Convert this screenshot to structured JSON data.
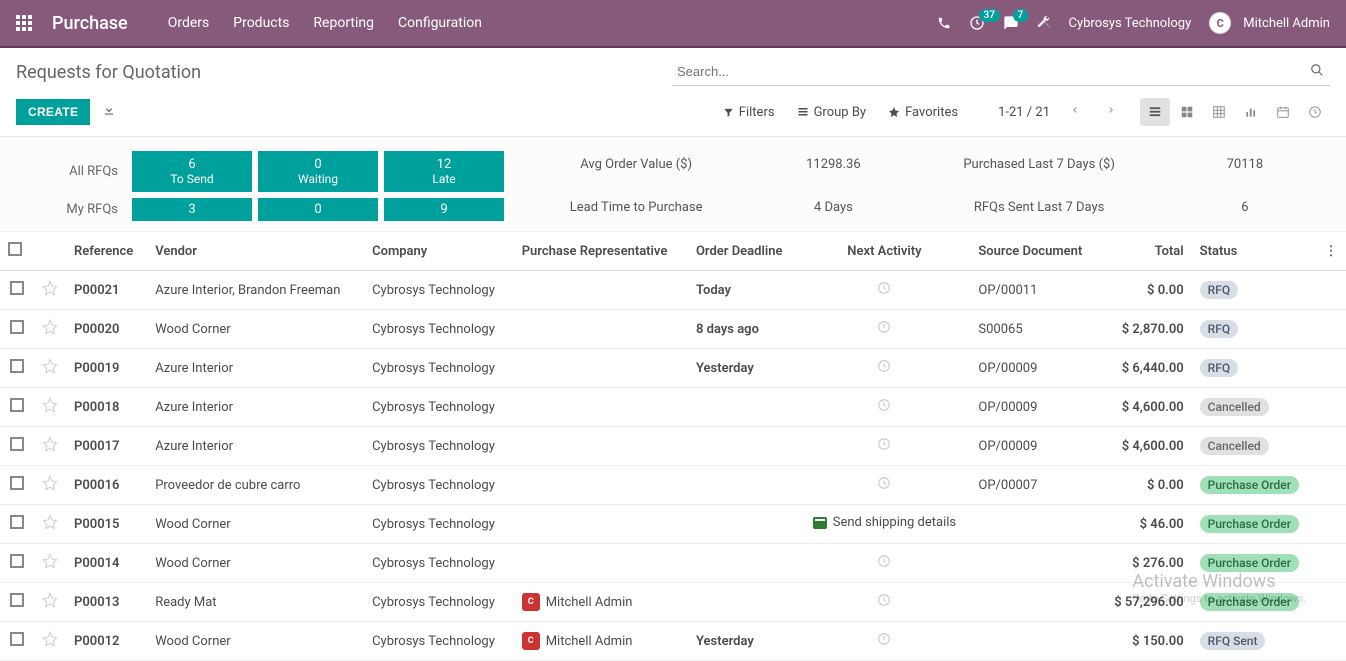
{
  "header": {
    "brand": "Purchase",
    "menu": [
      "Orders",
      "Products",
      "Reporting",
      "Configuration"
    ],
    "call_badge": "37",
    "msg_badge": "7",
    "company": "Cybrosys Technology",
    "user": "Mitchell Admin"
  },
  "page": {
    "title": "Requests for Quotation",
    "search_placeholder": "Search...",
    "create_label": "CREATE",
    "filters_label": "Filters",
    "groupby_label": "Group By",
    "favorites_label": "Favorites",
    "pager": "1-21 / 21"
  },
  "dashboard": {
    "row1_label": "All RFQs",
    "row2_label": "My RFQs",
    "tiles_top": [
      {
        "num": "6",
        "label": "To Send"
      },
      {
        "num": "0",
        "label": "Waiting"
      },
      {
        "num": "12",
        "label": "Late"
      }
    ],
    "tiles_bottom": [
      "3",
      "0",
      "9"
    ],
    "metrics": {
      "avg_label": "Avg Order Value ($)",
      "avg_value": "11298.36",
      "lead_label": "Lead Time to Purchase",
      "lead_value": "4  Days",
      "purchased_label": "Purchased Last 7 Days ($)",
      "purchased_value": "70118",
      "sent_label": "RFQs Sent Last 7 Days",
      "sent_value": "6"
    }
  },
  "table": {
    "headers": {
      "reference": "Reference",
      "vendor": "Vendor",
      "company": "Company",
      "rep": "Purchase Representative",
      "deadline": "Order Deadline",
      "activity": "Next Activity",
      "source": "Source Document",
      "total": "Total",
      "status": "Status"
    },
    "rows": [
      {
        "ref": "P00021",
        "vendor": "Azure Interior, Brandon Freeman",
        "company": "Cybrosys Technology",
        "rep": "",
        "deadline": "Today",
        "deadline_class": "deadline-today",
        "activity": "",
        "source": "OP/00011",
        "total": "$ 0.00",
        "status": "RFQ",
        "status_class": "status-rfq"
      },
      {
        "ref": "P00020",
        "vendor": "Wood Corner",
        "company": "Cybrosys Technology",
        "rep": "",
        "deadline": "8 days ago",
        "deadline_class": "deadline-past",
        "activity": "",
        "source": "S00065",
        "total": "$ 2,870.00",
        "status": "RFQ",
        "status_class": "status-rfq"
      },
      {
        "ref": "P00019",
        "vendor": "Azure Interior",
        "company": "Cybrosys Technology",
        "rep": "",
        "deadline": "Yesterday",
        "deadline_class": "deadline-past",
        "activity": "",
        "source": "OP/00009",
        "total": "$ 6,440.00",
        "status": "RFQ",
        "status_class": "status-rfq"
      },
      {
        "ref": "P00018",
        "vendor": "Azure Interior",
        "company": "Cybrosys Technology",
        "rep": "",
        "deadline": "",
        "deadline_class": "",
        "activity": "",
        "source": "OP/00009",
        "total": "$ 4,600.00",
        "status": "Cancelled",
        "status_class": "status-cancel"
      },
      {
        "ref": "P00017",
        "vendor": "Azure Interior",
        "company": "Cybrosys Technology",
        "rep": "",
        "deadline": "",
        "deadline_class": "",
        "activity": "",
        "source": "OP/00009",
        "total": "$ 4,600.00",
        "status": "Cancelled",
        "status_class": "status-cancel"
      },
      {
        "ref": "P00016",
        "vendor": "Proveedor de cubre carro",
        "company": "Cybrosys Technology",
        "rep": "",
        "deadline": "",
        "deadline_class": "",
        "activity": "",
        "source": "OP/00007",
        "total": "$ 0.00",
        "status": "Purchase Order",
        "status_class": "status-po"
      },
      {
        "ref": "P00015",
        "vendor": "Wood Corner",
        "company": "Cybrosys Technology",
        "rep": "",
        "deadline": "",
        "deadline_class": "",
        "activity": "Send shipping details",
        "source": "",
        "total": "$ 46.00",
        "status": "Purchase Order",
        "status_class": "status-po"
      },
      {
        "ref": "P00014",
        "vendor": "Wood Corner",
        "company": "Cybrosys Technology",
        "rep": "",
        "deadline": "",
        "deadline_class": "",
        "activity": "",
        "source": "",
        "total": "$ 276.00",
        "status": "Purchase Order",
        "status_class": "status-po"
      },
      {
        "ref": "P00013",
        "vendor": "Ready Mat",
        "company": "Cybrosys Technology",
        "rep": "Mitchell Admin",
        "deadline": "",
        "deadline_class": "",
        "activity": "",
        "source": "",
        "total": "$ 57,296.00",
        "status": "Purchase Order",
        "status_class": "status-po"
      },
      {
        "ref": "P00012",
        "vendor": "Wood Corner",
        "company": "Cybrosys Technology",
        "rep": "Mitchell Admin",
        "deadline": "Yesterday",
        "deadline_class": "deadline-past",
        "activity": "",
        "source": "",
        "total": "$ 150.00",
        "status": "RFQ Sent",
        "status_class": "status-sent"
      }
    ]
  },
  "watermark": {
    "big": "Activate Windows",
    "small": "Go to Settings to activate Windows."
  }
}
